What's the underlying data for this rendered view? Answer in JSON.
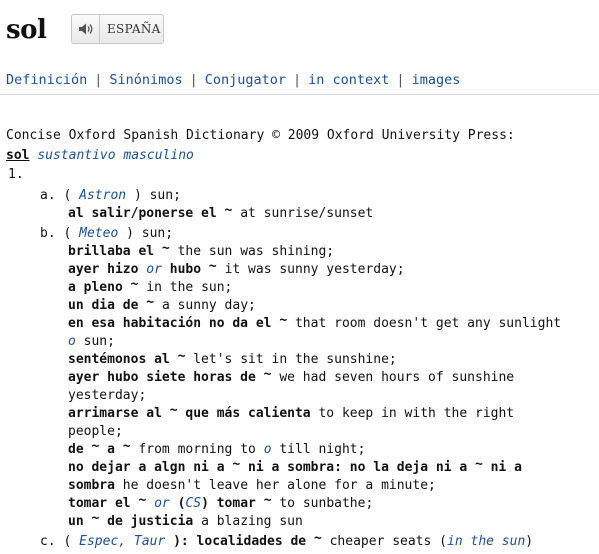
{
  "entry": {
    "headword": "sol",
    "audio_label": "ESPAÑA",
    "speaker_icon": "speaker-icon"
  },
  "nav": {
    "items": [
      "Definición",
      "Sinónimos",
      "Conjugator",
      "in context",
      "images"
    ]
  },
  "dictionary": {
    "copyright": "Concise Oxford Spanish Dictionary © 2009 Oxford University Press:",
    "head": "sol",
    "pos": "sustantivo masculino",
    "sense_number": "1.",
    "tilde": "~",
    "a": {
      "marker": "a.",
      "field_open": "(",
      "field": "Astron",
      "field_close": ")",
      "gloss": "sun;",
      "ex1_es": "al salir/ponerse el",
      "ex1_en": "at sunrise/sunset"
    },
    "b": {
      "marker": "b.",
      "field_open": "(",
      "field": "Meteo",
      "field_close": ")",
      "gloss": "sun;",
      "ex_brillaba_es": "brillaba el",
      "ex_brillaba_en": "the sun was shining;",
      "ex_ayer_es1": "ayer hizo",
      "ex_ayer_or": "or",
      "ex_ayer_es2": "hubo",
      "ex_ayer_en": "it was sunny yesterday;",
      "ex_pleno_es": "a pleno",
      "ex_pleno_en": "in the sun;",
      "ex_dia_es": "un dia de",
      "ex_dia_en": "a sunny day;",
      "ex_hab_es": "en esa habitación no da el",
      "ex_hab_en": "that room doesn't get any sunlight",
      "ex_hab_o": "o",
      "ex_hab_en2": "sun;",
      "ex_sent_es": "sentémonos al",
      "ex_sent_en": "let's sit in the sunshine;",
      "ex_siete_es": "ayer hubo siete horas de",
      "ex_siete_en": "we had seven hours of sunshine",
      "ex_siete_en2": "yesterday;",
      "ex_arr_es1": "arrimarse al",
      "ex_arr_es2": "que más calienta",
      "ex_arr_en": "to keep in with the right",
      "ex_arr_en2": "people;",
      "ex_de_es1": "de",
      "ex_de_es2": "a",
      "ex_de_en1": "from morning to",
      "ex_de_o": "o",
      "ex_de_en2": "till night;",
      "ex_nodejar_es1": "no dejar a algn ni a",
      "ex_nodejar_es2": "ni a sombra: no la deja ni a",
      "ex_nodejar_es3": "ni a",
      "ex_nodejar_es4": "sombra",
      "ex_nodejar_en": "he doesn't leave her alone for a minute;",
      "ex_tomar_es1": "tomar el",
      "ex_tomar_or": "or",
      "ex_tomar_open": "(",
      "ex_tomar_cs": "CS",
      "ex_tomar_close": ")",
      "ex_tomar_es2": "tomar",
      "ex_tomar_en": "to sunbathe;",
      "ex_justicia_es1": "un",
      "ex_justicia_es2": "de justicia",
      "ex_justicia_en": "a blazing sun"
    },
    "c": {
      "marker": "c.",
      "field_open": "(",
      "field": "Espec, Taur",
      "field_close": "):",
      "ex_es1": "localidades de",
      "ex_en": "cheaper seats (",
      "ex_note": "in the sun",
      "ex_close": ")"
    }
  }
}
